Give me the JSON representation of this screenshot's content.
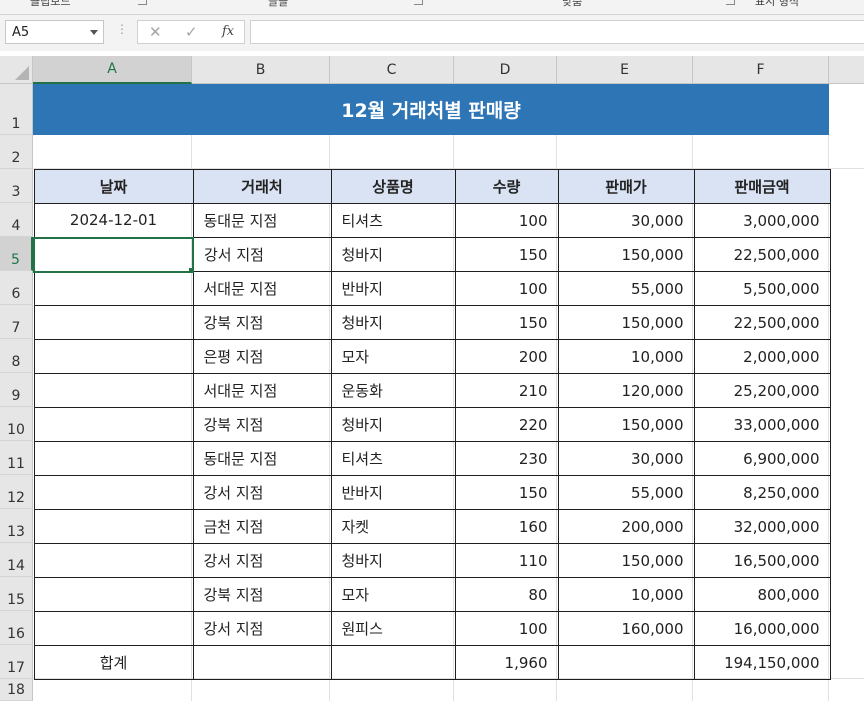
{
  "ribbon": {
    "groups": [
      "클립보드",
      "글꼴",
      "맞춤",
      "표시 형식"
    ]
  },
  "formula_bar": {
    "name_box": "A5",
    "cancel_glyph": "✕",
    "enter_glyph": "✓",
    "fx_label": "fx",
    "formula": ""
  },
  "columns": [
    "A",
    "B",
    "C",
    "D",
    "E",
    "F"
  ],
  "rows": [
    "1",
    "2",
    "3",
    "4",
    "5",
    "6",
    "7",
    "8",
    "9",
    "10",
    "11",
    "12",
    "13",
    "14",
    "15",
    "16",
    "17",
    "18"
  ],
  "selected_cell": {
    "column": "A",
    "row": "5"
  },
  "sheet": {
    "title": "12월 거래처별 판매량",
    "headers": [
      "날짜",
      "거래처",
      "상품명",
      "수량",
      "판매가",
      "판매금액"
    ],
    "records": [
      {
        "date": "2024-12-01",
        "client": "동대문 지점",
        "product": "티셔츠",
        "qty": "100",
        "price": "30,000",
        "amount": "3,000,000"
      },
      {
        "date": "",
        "client": "강서 지점",
        "product": "청바지",
        "qty": "150",
        "price": "150,000",
        "amount": "22,500,000"
      },
      {
        "date": "",
        "client": "서대문 지점",
        "product": "반바지",
        "qty": "100",
        "price": "55,000",
        "amount": "5,500,000"
      },
      {
        "date": "",
        "client": "강북 지점",
        "product": "청바지",
        "qty": "150",
        "price": "150,000",
        "amount": "22,500,000"
      },
      {
        "date": "",
        "client": "은평 지점",
        "product": "모자",
        "qty": "200",
        "price": "10,000",
        "amount": "2,000,000"
      },
      {
        "date": "",
        "client": "서대문 지점",
        "product": "운동화",
        "qty": "210",
        "price": "120,000",
        "amount": "25,200,000"
      },
      {
        "date": "",
        "client": "강북 지점",
        "product": "청바지",
        "qty": "220",
        "price": "150,000",
        "amount": "33,000,000"
      },
      {
        "date": "",
        "client": "동대문 지점",
        "product": "티셔츠",
        "qty": "230",
        "price": "30,000",
        "amount": "6,900,000"
      },
      {
        "date": "",
        "client": "강서 지점",
        "product": "반바지",
        "qty": "150",
        "price": "55,000",
        "amount": "8,250,000"
      },
      {
        "date": "",
        "client": "금천 지점",
        "product": "자켓",
        "qty": "160",
        "price": "200,000",
        "amount": "32,000,000"
      },
      {
        "date": "",
        "client": "강서  지점",
        "product": "청바지",
        "qty": "110",
        "price": "150,000",
        "amount": "16,500,000"
      },
      {
        "date": "",
        "client": "강북 지점",
        "product": "모자",
        "qty": "80",
        "price": "10,000",
        "amount": "800,000"
      },
      {
        "date": "",
        "client": "강서 지점",
        "product": "원피스",
        "qty": "100",
        "price": "160,000",
        "amount": "16,000,000"
      }
    ],
    "total": {
      "label": "합계",
      "qty": "1,960",
      "amount": "194,150,000"
    }
  },
  "colors": {
    "title_fill": "#2e75b6",
    "header_fill": "#dae3f3",
    "selection": "#217346"
  }
}
